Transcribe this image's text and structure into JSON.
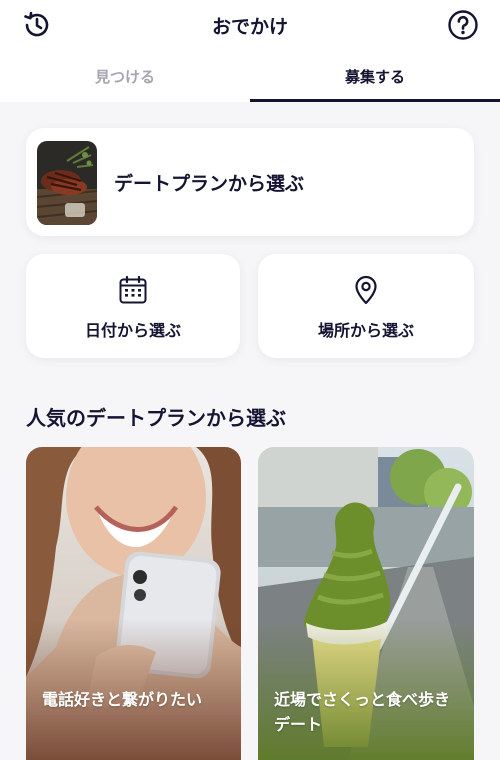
{
  "header": {
    "title": "おでかけ",
    "history_icon": "history-icon",
    "help_icon": "help-icon"
  },
  "tabs": [
    {
      "label": "見つける",
      "selected": false
    },
    {
      "label": "募集する",
      "selected": true
    }
  ],
  "plan_card": {
    "label": "デートプランから選ぶ"
  },
  "date_card": {
    "label": "日付から選ぶ",
    "icon": "calendar-icon"
  },
  "place_card": {
    "label": "場所から選ぶ",
    "icon": "location-pin-icon"
  },
  "popular": {
    "title": "人気のデートプランから選ぶ",
    "plans": [
      {
        "label": "電話好きと繋がりたい",
        "image": "woman-smartphone-photo"
      },
      {
        "label": "近場でさくっと食べ歩きデート",
        "image": "matcha-soft-serve-photo"
      }
    ]
  },
  "colors": {
    "text": "#141433",
    "tab_inactive": "#a5a6b0",
    "background": "#f6f6f8",
    "card": "#ffffff"
  }
}
